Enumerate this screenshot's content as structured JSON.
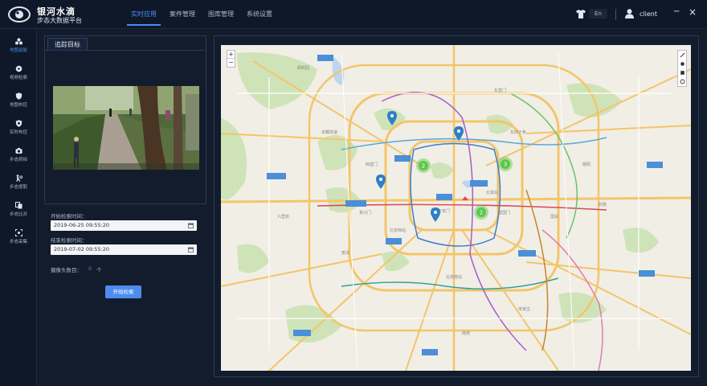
{
  "brand": {
    "line1": "银河水滴",
    "line2": "步态大数据平台"
  },
  "nav": [
    {
      "label": "实时应用",
      "active": true
    },
    {
      "label": "案件管理",
      "active": false
    },
    {
      "label": "图库管理",
      "active": false
    },
    {
      "label": "系统设置",
      "active": false
    }
  ],
  "header": {
    "lang": "En",
    "user": "client",
    "min": "−",
    "close": "×"
  },
  "sidebar": [
    {
      "label": "地图巡航",
      "icon": "map-cluster-icon",
      "active": true
    },
    {
      "label": "视频检索",
      "icon": "video-search-icon",
      "active": false
    },
    {
      "label": "地图布控",
      "icon": "shield-map-icon",
      "active": false
    },
    {
      "label": "实时布控",
      "icon": "shield-realtime-icon",
      "active": false
    },
    {
      "label": "步态抓拍",
      "icon": "camera-icon",
      "active": false
    },
    {
      "label": "步态提取",
      "icon": "gait-extract-icon",
      "active": false
    },
    {
      "label": "步态比对",
      "icon": "compare-icon",
      "active": false
    },
    {
      "label": "步态采集",
      "icon": "collect-icon",
      "active": false
    }
  ],
  "panel": {
    "tab": "追踪目标",
    "start_label": "开始检索时间：",
    "start_value": "2019-06-25 09:55:20",
    "end_label": "结束检索时间：",
    "end_value": "2019-07-02 09:55:20",
    "camera_label": "摄像头数目：",
    "camera_count": "0",
    "camera_unit": "个",
    "button": "开始检索"
  },
  "map": {
    "zoom_in": "+",
    "zoom_out": "−",
    "clusters": [
      "2",
      "3",
      "2"
    ],
    "road_labels": [
      "京藏高速",
      "北京站",
      "东直门",
      "东四十条",
      "西直门",
      "复兴门",
      "天安门",
      "建国门",
      "国贸",
      "六里桥",
      "丽泽",
      "南苑",
      "宋家庄",
      "四惠",
      "朝阳",
      "颐和园",
      "北京西站",
      "北京南站"
    ]
  },
  "colors": {
    "accent": "#4d8cf0",
    "cluster": "#5cc64a",
    "pin": "#2f7ec7"
  }
}
